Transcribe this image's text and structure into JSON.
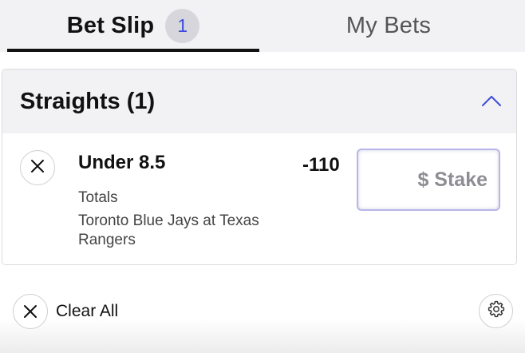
{
  "tabs": {
    "bet_slip": {
      "label": "Bet Slip",
      "count": "1",
      "active": true
    },
    "my_bets": {
      "label": "My Bets",
      "active": false
    }
  },
  "section": {
    "title": "Straights (1)",
    "state": "expanded",
    "toggle_icon": "chevron-up-icon"
  },
  "bet": {
    "selection": "Under 8.5",
    "market": "Totals",
    "event": "Toronto Blue Jays at Texas Rangers",
    "odds": "-110",
    "stake": {
      "value": "",
      "placeholder": "$ Stake"
    },
    "remove_icon": "close-icon"
  },
  "footer": {
    "clear_all_label": "Clear All",
    "clear_icon": "close-icon",
    "settings_icon": "gear-icon"
  },
  "colors": {
    "accent": "#3b4ad8",
    "header_bg": "#f2f2f4",
    "badge_bg": "#d6d6dc",
    "stake_border": "#b8b6e8",
    "text": "#111111",
    "muted_text": "#444444"
  }
}
